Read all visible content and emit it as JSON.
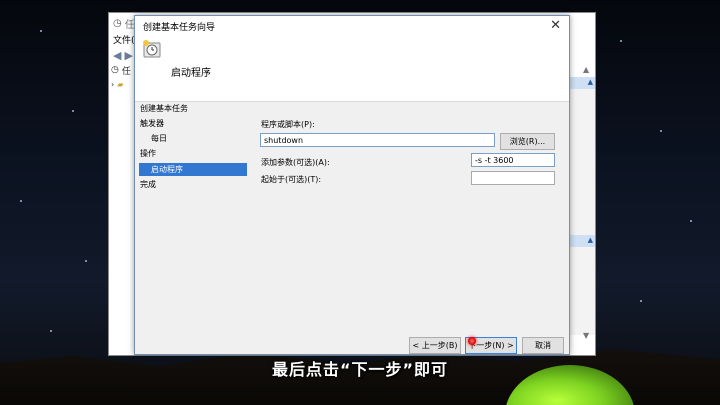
{
  "background_window": {
    "title_partial": "任",
    "menu_partial": "文件(F",
    "tree_partial": "任"
  },
  "dialog": {
    "title": "创建基本任务向导",
    "header_title": "启动程序",
    "steps": [
      {
        "label": "创建基本任务"
      },
      {
        "label": "触发器"
      },
      {
        "label": "每日"
      },
      {
        "label": "操作"
      },
      {
        "label": "启动程序"
      },
      {
        "label": "完成"
      }
    ],
    "program_label": "程序或脚本(P):",
    "program_value": "shutdown",
    "browse_button": "浏览(R)...",
    "args_label": "添加参数(可选)(A):",
    "args_value": "-s -t 3600",
    "startin_label": "起始于(可选)(T):",
    "startin_value": "",
    "back_button": "< 上一步(B)",
    "next_button": "下一步(N) >",
    "cancel_button": "取消",
    "close_glyph": "✕"
  },
  "subtitle": "最后点击“下一步”即可",
  "colors": {
    "selection": "#3277d0",
    "dialog_bg": "#f0f0f0",
    "input_border": "#7a9ec8",
    "tent": "#7ed321"
  },
  "icons": [
    "task-scheduler-icon",
    "close-icon",
    "back-arrow-icon",
    "forward-arrow-icon",
    "clock-icon"
  ]
}
